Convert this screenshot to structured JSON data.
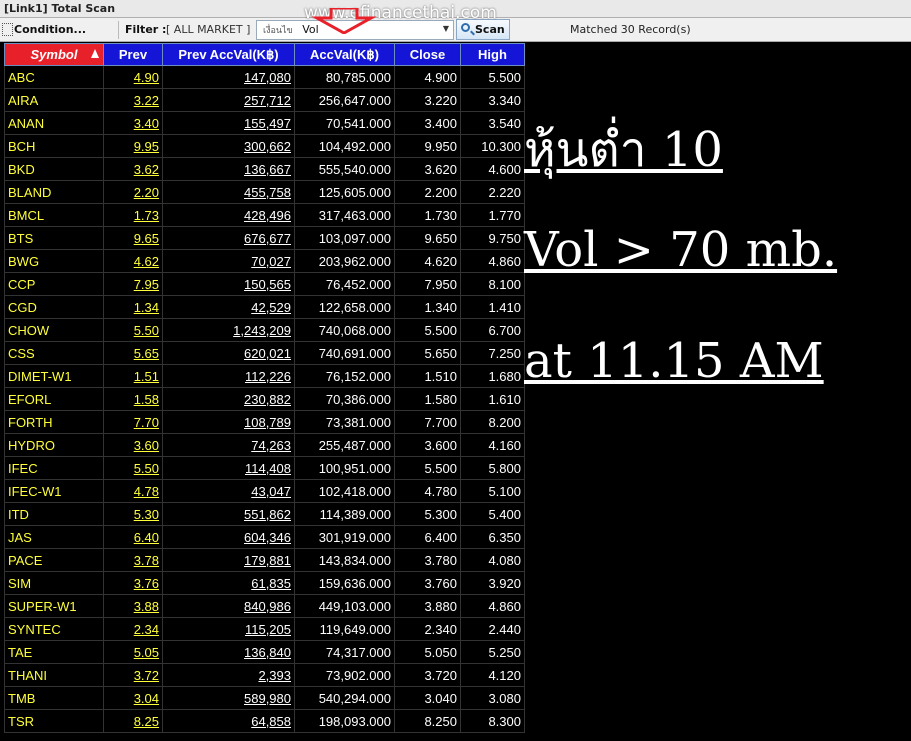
{
  "window": {
    "title": "[Link1] Total Scan"
  },
  "toolbar": {
    "condition_label": "Condition...",
    "filter_label": "Filter :",
    "filter_value": "[ ALL MARKET ]",
    "condition_prefix": "เงื่อนไข",
    "condition_value": "Vol",
    "scan_label": "Scan",
    "matched_text": "Matched 30 Record(s)",
    "watermark": "www.efinancethai.com"
  },
  "colors": {
    "symbol_header": "#e8202a",
    "header": "#1515d8",
    "symbol_text": "#ffff3a",
    "value_text": "#ffffff",
    "background": "#000000"
  },
  "table": {
    "headers": {
      "symbol": "Symbol",
      "prev": "Prev",
      "prev_accval": "Prev AccVal(K฿)",
      "accval": "AccVal(K฿)",
      "close": "Close",
      "high": "High"
    },
    "rows": [
      [
        "ABC",
        "4.90",
        "147,080",
        "80,785.000",
        "4.900",
        "5.500"
      ],
      [
        "AIRA",
        "3.22",
        "257,712",
        "256,647.000",
        "3.220",
        "3.340"
      ],
      [
        "ANAN",
        "3.40",
        "155,497",
        "70,541.000",
        "3.400",
        "3.540"
      ],
      [
        "BCH",
        "9.95",
        "300,662",
        "104,492.000",
        "9.950",
        "10.300"
      ],
      [
        "BKD",
        "3.62",
        "136,667",
        "555,540.000",
        "3.620",
        "4.600"
      ],
      [
        "BLAND",
        "2.20",
        "455,758",
        "125,605.000",
        "2.200",
        "2.220"
      ],
      [
        "BMCL",
        "1.73",
        "428,496",
        "317,463.000",
        "1.730",
        "1.770"
      ],
      [
        "BTS",
        "9.65",
        "676,677",
        "103,097.000",
        "9.650",
        "9.750"
      ],
      [
        "BWG",
        "4.62",
        "70,027",
        "203,962.000",
        "4.620",
        "4.860"
      ],
      [
        "CCP",
        "7.95",
        "150,565",
        "76,452.000",
        "7.950",
        "8.100"
      ],
      [
        "CGD",
        "1.34",
        "42,529",
        "122,658.000",
        "1.340",
        "1.410"
      ],
      [
        "CHOW",
        "5.50",
        "1,243,209",
        "740,068.000",
        "5.500",
        "6.700"
      ],
      [
        "CSS",
        "5.65",
        "620,021",
        "740,691.000",
        "5.650",
        "7.250"
      ],
      [
        "DIMET-W1",
        "1.51",
        "112,226",
        "76,152.000",
        "1.510",
        "1.680"
      ],
      [
        "EFORL",
        "1.58",
        "230,882",
        "70,386.000",
        "1.580",
        "1.610"
      ],
      [
        "FORTH",
        "7.70",
        "108,789",
        "73,381.000",
        "7.700",
        "8.200"
      ],
      [
        "HYDRO",
        "3.60",
        "74,263",
        "255,487.000",
        "3.600",
        "4.160"
      ],
      [
        "IFEC",
        "5.50",
        "114,408",
        "100,951.000",
        "5.500",
        "5.800"
      ],
      [
        "IFEC-W1",
        "4.78",
        "43,047",
        "102,418.000",
        "4.780",
        "5.100"
      ],
      [
        "ITD",
        "5.30",
        "551,862",
        "114,389.000",
        "5.300",
        "5.400"
      ],
      [
        "JAS",
        "6.40",
        "604,346",
        "301,919.000",
        "6.400",
        "6.350"
      ],
      [
        "PACE",
        "3.78",
        "179,881",
        "143,834.000",
        "3.780",
        "4.080"
      ],
      [
        "SIM",
        "3.76",
        "61,835",
        "159,636.000",
        "3.760",
        "3.920"
      ],
      [
        "SUPER-W1",
        "3.88",
        "840,986",
        "449,103.000",
        "3.880",
        "4.860"
      ],
      [
        "SYNTEC",
        "2.34",
        "115,205",
        "119,649.000",
        "2.340",
        "2.440"
      ],
      [
        "TAE",
        "5.05",
        "136,840",
        "74,317.000",
        "5.050",
        "5.250"
      ],
      [
        "THANI",
        "3.72",
        "2,393",
        "73,902.000",
        "3.720",
        "4.120"
      ],
      [
        "TMB",
        "3.04",
        "589,980",
        "540,294.000",
        "3.040",
        "3.080"
      ],
      [
        "TSR",
        "8.25",
        "64,858",
        "198,093.000",
        "8.250",
        "8.300"
      ]
    ]
  },
  "annotations": {
    "line1": "หุ้นต่ำ 10",
    "line2": "Vol > 70 mb.",
    "line3": "at 11.15 AM"
  }
}
